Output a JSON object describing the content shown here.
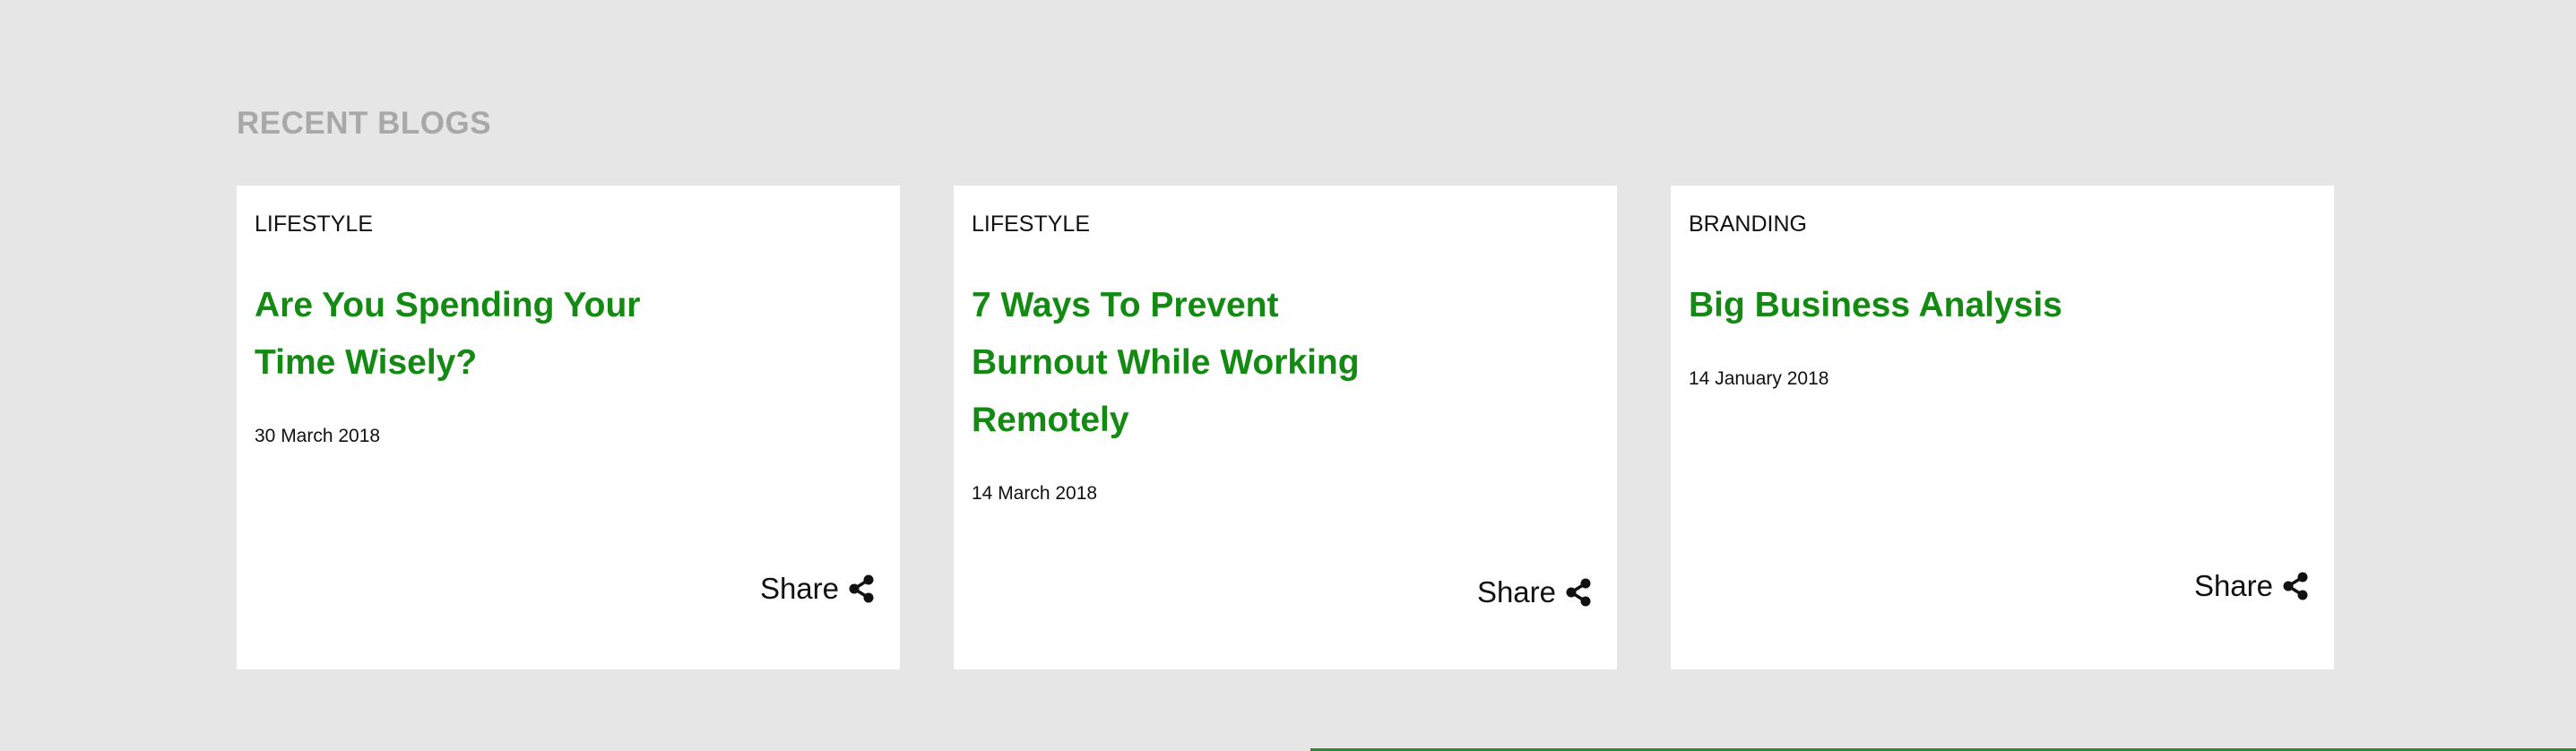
{
  "section": {
    "title": "RECENT BLOGS"
  },
  "cards": [
    {
      "category": "LIFESTYLE",
      "title": "Are You Spending Your Time Wisely?",
      "date": "30 March 2018",
      "share_label": "Share",
      "share_icon": "share-icon"
    },
    {
      "category": "LIFESTYLE",
      "title": "7 Ways To Prevent Burnout While Working Remotely",
      "date": "14 March 2018",
      "share_label": "Share",
      "share_icon": "share-icon"
    },
    {
      "category": "BRANDING",
      "title": "Big Business Analysis",
      "date": "14 January 2018",
      "share_label": "Share",
      "share_icon": "share-icon"
    }
  ],
  "colors": {
    "background": "#e6e6e6",
    "title_green": "#138a12",
    "section_gray": "#a8a8a8",
    "text": "#111111",
    "footer_green": "#2f8a2f"
  }
}
